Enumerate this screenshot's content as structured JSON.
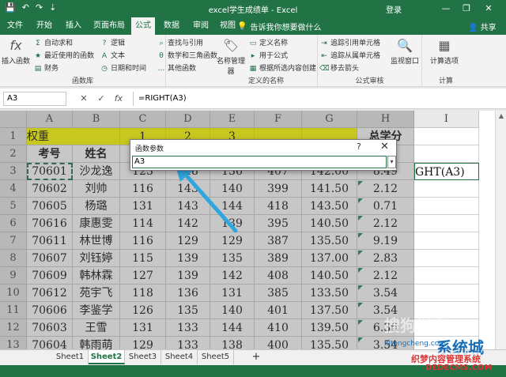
{
  "window": {
    "title": "excel学生成绩单 - Excel",
    "login": "登录",
    "minimize": "—",
    "restore": "❐",
    "close": "✕"
  },
  "quick_access": {
    "save": "💾",
    "undo": "↶",
    "redo": "↷",
    "customize": "⇣"
  },
  "tabs": [
    "文件",
    "开始",
    "插入",
    "页面布局",
    "公式",
    "数据",
    "审阅",
    "视图"
  ],
  "active_tab": "公式",
  "tell_me": "告诉我你想要做什么",
  "share": "共享",
  "ribbon": {
    "insert_function": "插入函数",
    "autosum": "自动求和",
    "recent": "最近使用的函数",
    "financial": "财务",
    "logical": "逻辑",
    "text": "文本",
    "datetime": "日期和时间",
    "lookup": "查找与引用",
    "math": "数学和三角函数",
    "more": "其他函数",
    "group_library": "函数库",
    "name_manager": "名称管理器",
    "define_name": "定义名称",
    "use_in_formula": "用于公式",
    "create_from_selection": "根据所选内容创建",
    "group_names": "定义的名称",
    "trace_precedents": "追踪引用单元格",
    "trace_dependents": "追踪从属单元格",
    "remove_arrows": "移去箭头",
    "watch_window": "监视窗口",
    "group_audit": "公式审核",
    "calc_options": "计算选项",
    "group_calc": "计算"
  },
  "formula_bar": {
    "name_box": "A3",
    "cancel": "✕",
    "enter": "✓",
    "fx": "fx",
    "formula": "=RIGHT(A3)"
  },
  "columns": [
    "A",
    "B",
    "C",
    "D",
    "E",
    "F",
    "G",
    "H",
    "I"
  ],
  "rows": [
    "1",
    "2",
    "3",
    "4",
    "5",
    "6",
    "7",
    "8",
    "9",
    "10",
    "11",
    "12",
    "13"
  ],
  "row1": {
    "a": "权重",
    "c": "1",
    "d": "2",
    "e": "3",
    "h": "总学分"
  },
  "row2": {
    "a": "考号",
    "b": "姓名",
    "h": "学"
  },
  "data_rows": [
    [
      "70601",
      "沙龙逸",
      "123",
      "148",
      "136",
      "407",
      "142.00",
      "8.49"
    ],
    [
      "70602",
      "刘帅",
      "116",
      "143",
      "140",
      "399",
      "141.50",
      "2.12"
    ],
    [
      "70605",
      "杨璐",
      "131",
      "143",
      "144",
      "418",
      "143.50",
      "0.71"
    ],
    [
      "70616",
      "康惠雯",
      "114",
      "142",
      "139",
      "395",
      "140.50",
      "2.12"
    ],
    [
      "70611",
      "林世博",
      "116",
      "129",
      "129",
      "387",
      "135.50",
      "9.19"
    ],
    [
      "70607",
      "刘钰婷",
      "115",
      "139",
      "135",
      "389",
      "137.00",
      "2.83"
    ],
    [
      "70609",
      "韩林霖",
      "127",
      "139",
      "142",
      "408",
      "140.50",
      "2.12"
    ],
    [
      "70612",
      "苑宇飞",
      "118",
      "136",
      "131",
      "385",
      "133.50",
      "3.54"
    ],
    [
      "70606",
      "李鉴学",
      "126",
      "135",
      "140",
      "401",
      "137.50",
      "3.54"
    ],
    [
      "70603",
      "王雪",
      "131",
      "133",
      "144",
      "410",
      "139.50",
      "6.36"
    ],
    [
      "70604",
      "韩雨萌",
      "129",
      "133",
      "138",
      "400",
      "135.50",
      "3.54"
    ]
  ],
  "editing_cell": "GHT(A3)",
  "dialog": {
    "title": "函数参数",
    "help": "?",
    "close": "✕",
    "value": "A3",
    "collapse": "▾"
  },
  "sheets": [
    "Sheet1",
    "Sheet2",
    "Sheet3",
    "Sheet4",
    "Sheet5"
  ],
  "active_sheet": "Sheet2",
  "add_sheet": "+",
  "watermarks": {
    "w1": "搜狗指南",
    "w2": "系统城",
    "w3": "织梦内容管理系统",
    "w4": "DEDECMS.COM",
    "w5": "xitongcheng.com"
  },
  "colors": {
    "excel_green": "#217346",
    "header_yellow": "#ffff00",
    "arrow_blue": "#2fa6de"
  }
}
